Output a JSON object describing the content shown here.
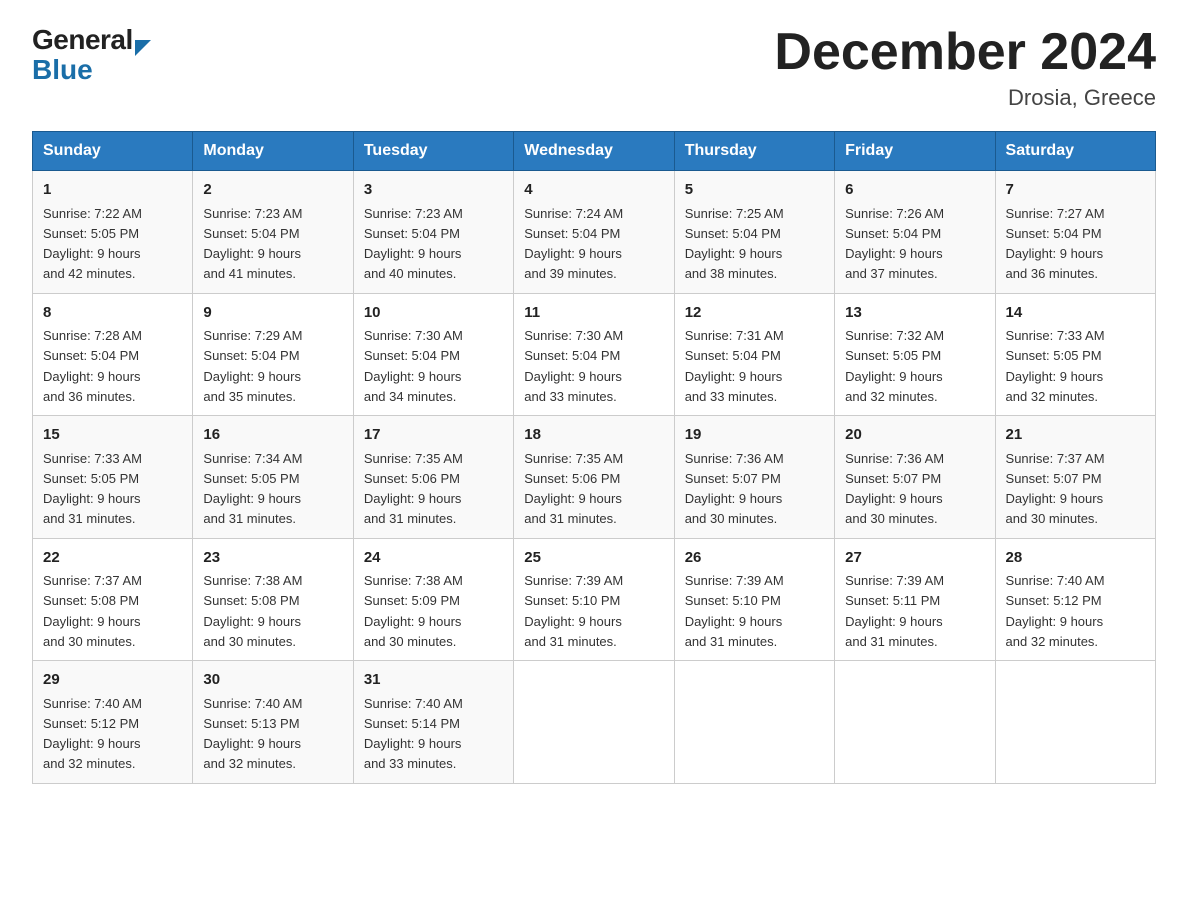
{
  "logo": {
    "general": "General",
    "blue": "Blue"
  },
  "title": "December 2024",
  "location": "Drosia, Greece",
  "days_of_week": [
    "Sunday",
    "Monday",
    "Tuesday",
    "Wednesday",
    "Thursday",
    "Friday",
    "Saturday"
  ],
  "weeks": [
    [
      {
        "day": "1",
        "sunrise": "7:22 AM",
        "sunset": "5:05 PM",
        "daylight": "9 hours and 42 minutes."
      },
      {
        "day": "2",
        "sunrise": "7:23 AM",
        "sunset": "5:04 PM",
        "daylight": "9 hours and 41 minutes."
      },
      {
        "day": "3",
        "sunrise": "7:23 AM",
        "sunset": "5:04 PM",
        "daylight": "9 hours and 40 minutes."
      },
      {
        "day": "4",
        "sunrise": "7:24 AM",
        "sunset": "5:04 PM",
        "daylight": "9 hours and 39 minutes."
      },
      {
        "day": "5",
        "sunrise": "7:25 AM",
        "sunset": "5:04 PM",
        "daylight": "9 hours and 38 minutes."
      },
      {
        "day": "6",
        "sunrise": "7:26 AM",
        "sunset": "5:04 PM",
        "daylight": "9 hours and 37 minutes."
      },
      {
        "day": "7",
        "sunrise": "7:27 AM",
        "sunset": "5:04 PM",
        "daylight": "9 hours and 36 minutes."
      }
    ],
    [
      {
        "day": "8",
        "sunrise": "7:28 AM",
        "sunset": "5:04 PM",
        "daylight": "9 hours and 36 minutes."
      },
      {
        "day": "9",
        "sunrise": "7:29 AM",
        "sunset": "5:04 PM",
        "daylight": "9 hours and 35 minutes."
      },
      {
        "day": "10",
        "sunrise": "7:30 AM",
        "sunset": "5:04 PM",
        "daylight": "9 hours and 34 minutes."
      },
      {
        "day": "11",
        "sunrise": "7:30 AM",
        "sunset": "5:04 PM",
        "daylight": "9 hours and 33 minutes."
      },
      {
        "day": "12",
        "sunrise": "7:31 AM",
        "sunset": "5:04 PM",
        "daylight": "9 hours and 33 minutes."
      },
      {
        "day": "13",
        "sunrise": "7:32 AM",
        "sunset": "5:05 PM",
        "daylight": "9 hours and 32 minutes."
      },
      {
        "day": "14",
        "sunrise": "7:33 AM",
        "sunset": "5:05 PM",
        "daylight": "9 hours and 32 minutes."
      }
    ],
    [
      {
        "day": "15",
        "sunrise": "7:33 AM",
        "sunset": "5:05 PM",
        "daylight": "9 hours and 31 minutes."
      },
      {
        "day": "16",
        "sunrise": "7:34 AM",
        "sunset": "5:05 PM",
        "daylight": "9 hours and 31 minutes."
      },
      {
        "day": "17",
        "sunrise": "7:35 AM",
        "sunset": "5:06 PM",
        "daylight": "9 hours and 31 minutes."
      },
      {
        "day": "18",
        "sunrise": "7:35 AM",
        "sunset": "5:06 PM",
        "daylight": "9 hours and 31 minutes."
      },
      {
        "day": "19",
        "sunrise": "7:36 AM",
        "sunset": "5:07 PM",
        "daylight": "9 hours and 30 minutes."
      },
      {
        "day": "20",
        "sunrise": "7:36 AM",
        "sunset": "5:07 PM",
        "daylight": "9 hours and 30 minutes."
      },
      {
        "day": "21",
        "sunrise": "7:37 AM",
        "sunset": "5:07 PM",
        "daylight": "9 hours and 30 minutes."
      }
    ],
    [
      {
        "day": "22",
        "sunrise": "7:37 AM",
        "sunset": "5:08 PM",
        "daylight": "9 hours and 30 minutes."
      },
      {
        "day": "23",
        "sunrise": "7:38 AM",
        "sunset": "5:08 PM",
        "daylight": "9 hours and 30 minutes."
      },
      {
        "day": "24",
        "sunrise": "7:38 AM",
        "sunset": "5:09 PM",
        "daylight": "9 hours and 30 minutes."
      },
      {
        "day": "25",
        "sunrise": "7:39 AM",
        "sunset": "5:10 PM",
        "daylight": "9 hours and 31 minutes."
      },
      {
        "day": "26",
        "sunrise": "7:39 AM",
        "sunset": "5:10 PM",
        "daylight": "9 hours and 31 minutes."
      },
      {
        "day": "27",
        "sunrise": "7:39 AM",
        "sunset": "5:11 PM",
        "daylight": "9 hours and 31 minutes."
      },
      {
        "day": "28",
        "sunrise": "7:40 AM",
        "sunset": "5:12 PM",
        "daylight": "9 hours and 32 minutes."
      }
    ],
    [
      {
        "day": "29",
        "sunrise": "7:40 AM",
        "sunset": "5:12 PM",
        "daylight": "9 hours and 32 minutes."
      },
      {
        "day": "30",
        "sunrise": "7:40 AM",
        "sunset": "5:13 PM",
        "daylight": "9 hours and 32 minutes."
      },
      {
        "day": "31",
        "sunrise": "7:40 AM",
        "sunset": "5:14 PM",
        "daylight": "9 hours and 33 minutes."
      },
      null,
      null,
      null,
      null
    ]
  ],
  "labels": {
    "sunrise": "Sunrise:",
    "sunset": "Sunset:",
    "daylight": "Daylight:"
  }
}
